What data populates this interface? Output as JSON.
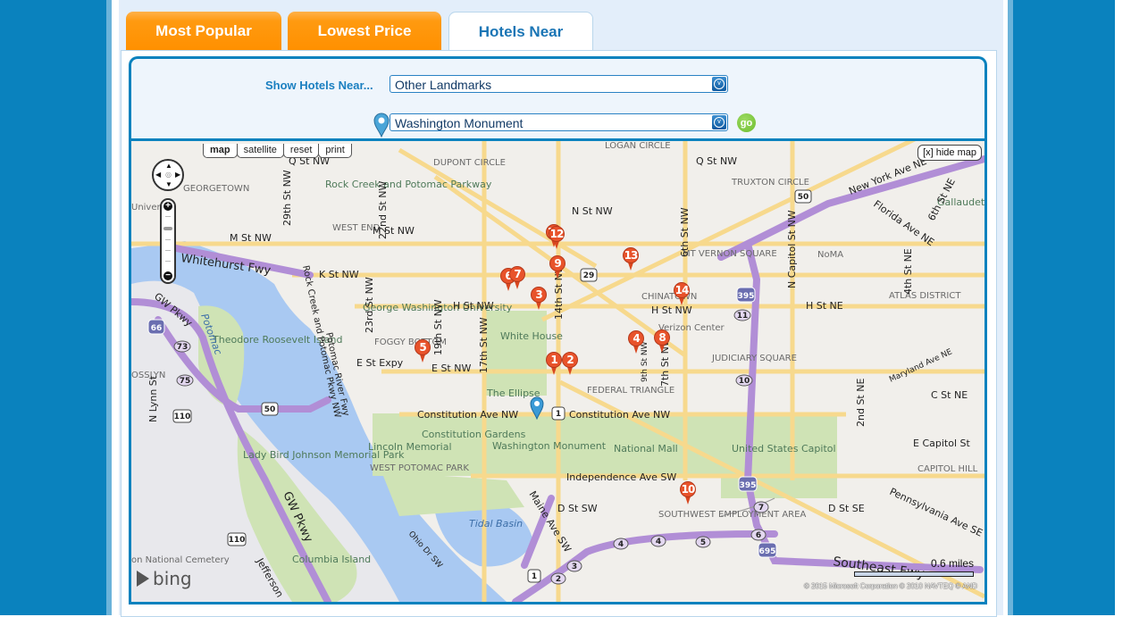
{
  "tabs": [
    {
      "label": "Most Popular",
      "active": false
    },
    {
      "label": "Lowest Price",
      "active": false
    },
    {
      "label": "Hotels Near",
      "active": true
    }
  ],
  "search": {
    "label": "Show Hotels Near...",
    "category_select": {
      "value": "Other Landmarks"
    },
    "landmark_select": {
      "value": "Washington Monument"
    },
    "go_label": "go"
  },
  "map": {
    "view_buttons": [
      {
        "label": "map",
        "active": true
      },
      {
        "label": "satellite",
        "active": false
      },
      {
        "label": "reset",
        "active": false
      },
      {
        "label": "print",
        "active": false
      }
    ],
    "hide_map_label": "[x] hide map",
    "provider": "bing",
    "scale_label": "0.6 miles",
    "copyright": "© 2015 Microsoft Corporation   © 2010 NAVTEQ  © AND",
    "landmark_marker": "Washington Monument",
    "hotel_markers": [
      "1",
      "2",
      "3",
      "4",
      "5",
      "6",
      "7",
      "8",
      "9",
      "10",
      "11",
      "12",
      "13",
      "14"
    ],
    "place_labels": {
      "georgetown": "GEORGETOWN",
      "rock_creek": "Rock Creek and Potomac Parkway",
      "west_end": "WEST END",
      "dupont": "DUPONT CIRCLE",
      "logan": "LOGAN CIRCLE",
      "truxton": "TRUXTON CIRCLE",
      "gallaudet": "Gallaudet University",
      "noma": "NoMA",
      "mt_vernon": "MT VERNON SQUARE",
      "chinatown": "CHINATOWN",
      "verizon": "Verizon Center",
      "atlas": "ATLAS DISTRICT",
      "gwu": "George Washington University",
      "foggy": "FOGGY BOTTOM",
      "white_house": "White House",
      "ellipse": "The Ellipse",
      "federal_triangle": "FEDERAL TRIANGLE",
      "judiciary": "JUDICIARY SQUARE",
      "roosevelt": "Theodore Roosevelt Island",
      "potomac": "Potomac",
      "lincoln": "Lincoln Memorial",
      "constitution_gardens": "Constitution Gardens",
      "wash_monument": "Washington Monument",
      "national_mall": "National Mall",
      "capitol": "United States Capitol",
      "capitol_hill": "CAPITOL HILL",
      "west_potomac": "WEST POTOMAC PARK",
      "tidal_basin": "Tidal Basin",
      "lady_bird": "Lady Bird Johnson Memorial Park",
      "sw_employment": "SOUTHWEST EMPLOYMENT AREA",
      "columbia_island": "Columbia Island",
      "arlington_cemetery": "on National Cemetery",
      "rosslyn": "OSSLYN",
      "university": "Univers"
    },
    "street_labels": {
      "q_st": "Q St NW",
      "q_st_2": "Q St NW",
      "m_st": "M St NW",
      "m_st_2": "M St NW",
      "n_st": "N St NW",
      "k_st": "K St NW",
      "h_st": "H St NW",
      "h_st_2": "H St NW",
      "h_st_ne": "H St NE",
      "e_st": "E St NW",
      "e_expy": "E St Expy",
      "constitution": "Constitution Ave NW",
      "constitution_2": "Constitution Ave NW",
      "independence": "Independence Ave SW",
      "d_st_sw": "D St SW",
      "d_st_se": "D St SE",
      "c_st_ne": "C St NE",
      "e_capitol": "E Capitol St",
      "whitehurst": "Whitehurst Fwy",
      "gw_pkwy": "GW Pkwy",
      "gw_pkwy_2": "GW Pkwy",
      "new_york": "New York Ave NE",
      "florida": "Florida Ave NE",
      "maryland": "Maryland Ave NE",
      "pennsylvania": "Pennsylvania Ave SE",
      "maine": "Maine Ave SW",
      "ohio": "Ohio Dr SW",
      "southeast": "Southeast Fwy",
      "n_lynn": "N Lynn St",
      "jefferson": "Jefferson",
      "st_29": "29th St NW",
      "st_22": "22nd St NW",
      "st_23": "23rd St NW",
      "st_19": "19th St NW",
      "st_17": "17th St NW",
      "st_14": "14th St NW",
      "st_9": "9th St NW",
      "st_7": "7th St NW",
      "st_6": "6th St NW",
      "st_6_ne": "6th St NE",
      "st_4_ne": "4th St NE",
      "st_2_ne": "2nd St NE",
      "n_capitol": "N Capitol St NW",
      "rock_creek_pkwy": "Rock Creek and Potomac Pkwy NW",
      "potomac_river_fwy": "Potomac River Fwy"
    },
    "shields": {
      "us50": "50",
      "us50b": "50",
      "us29": "29",
      "us1": "1",
      "us1b": "1",
      "i66": "66",
      "i395": "395",
      "i395b": "395",
      "i695": "695",
      "r73": "73",
      "r75": "75",
      "r110": "110",
      "r110b": "110",
      "x2": "2",
      "x3": "3",
      "x4": "4",
      "x4b": "4",
      "x5": "5",
      "x6": "6",
      "x7": "7",
      "x10": "10",
      "x11": "11"
    }
  }
}
